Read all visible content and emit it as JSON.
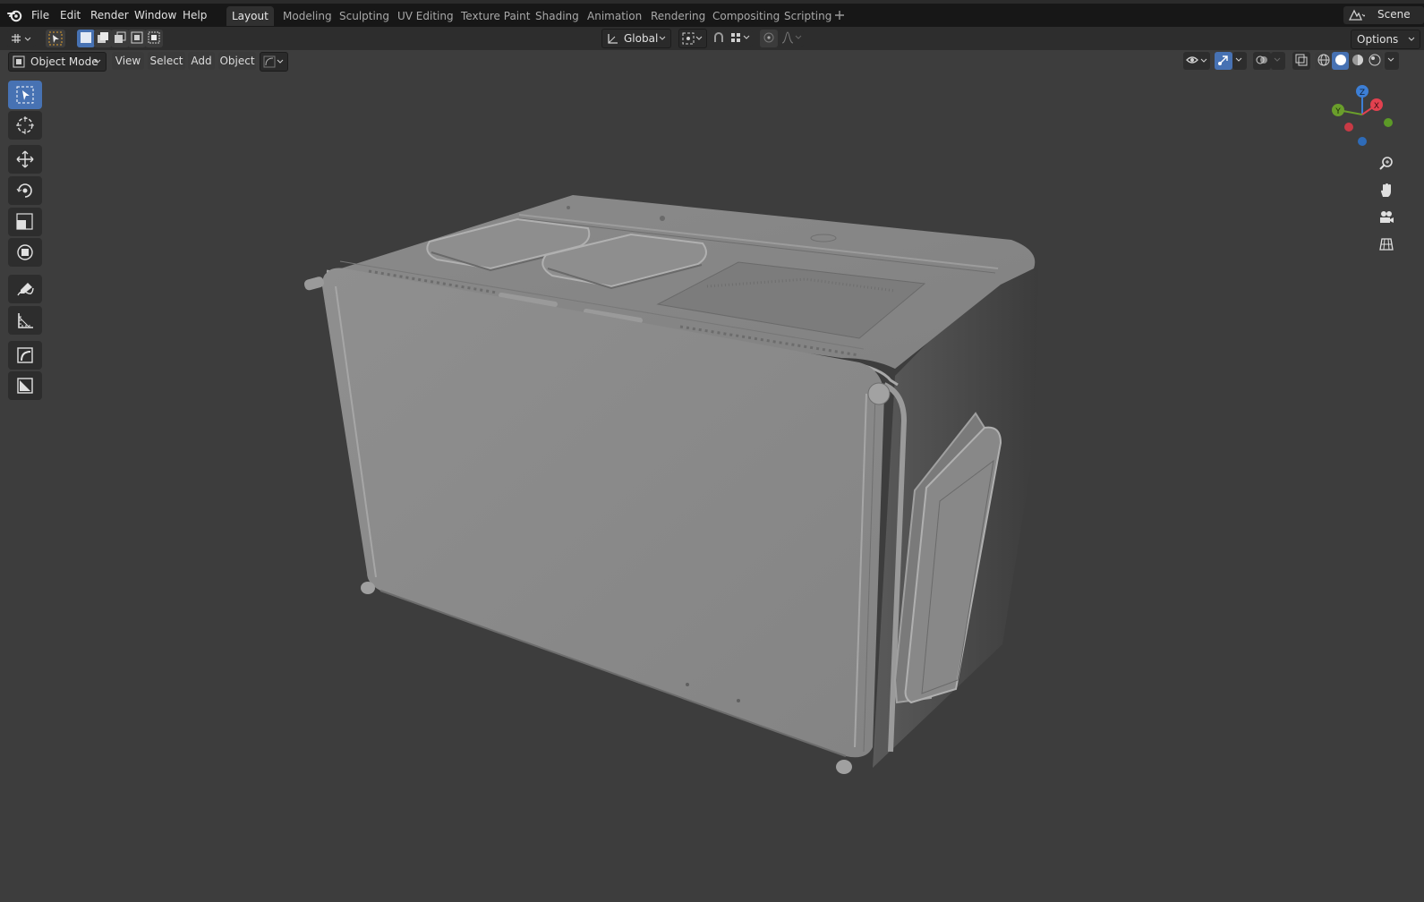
{
  "menu": {
    "file": "File",
    "edit": "Edit",
    "render": "Render",
    "window": "Window",
    "help": "Help"
  },
  "workspaces": [
    "Layout",
    "Modeling",
    "Sculpting",
    "UV Editing",
    "Texture Paint",
    "Shading",
    "Animation",
    "Rendering",
    "Compositing",
    "Scripting"
  ],
  "active_workspace": "Layout",
  "scene_label": "Scene",
  "tool_header": {
    "orientation": "Global",
    "options": "Options"
  },
  "viewport_header": {
    "mode": "Object Mode",
    "view": "View",
    "select": "Select",
    "add": "Add",
    "object": "Object"
  },
  "gizmo": {
    "z": "Z",
    "y": "Y",
    "x": "X"
  },
  "colors": {
    "accent": "#4772b3",
    "axis_x": "#e2414f",
    "axis_y": "#6a9e2b",
    "axis_z": "#3d7fd6",
    "viewport_bg": "#3d3d3d",
    "model_grey": "#8c8c8c"
  },
  "tools": [
    "select-box-icon",
    "cursor-icon",
    "move-icon",
    "rotate-icon",
    "scale-icon",
    "transform-icon",
    "annotate-icon",
    "measure-icon",
    "add-cube-icon",
    "add-plane-icon"
  ],
  "nav_icons": [
    "zoom-icon",
    "pan-hand-icon",
    "camera-icon",
    "ortho-grid-icon"
  ]
}
